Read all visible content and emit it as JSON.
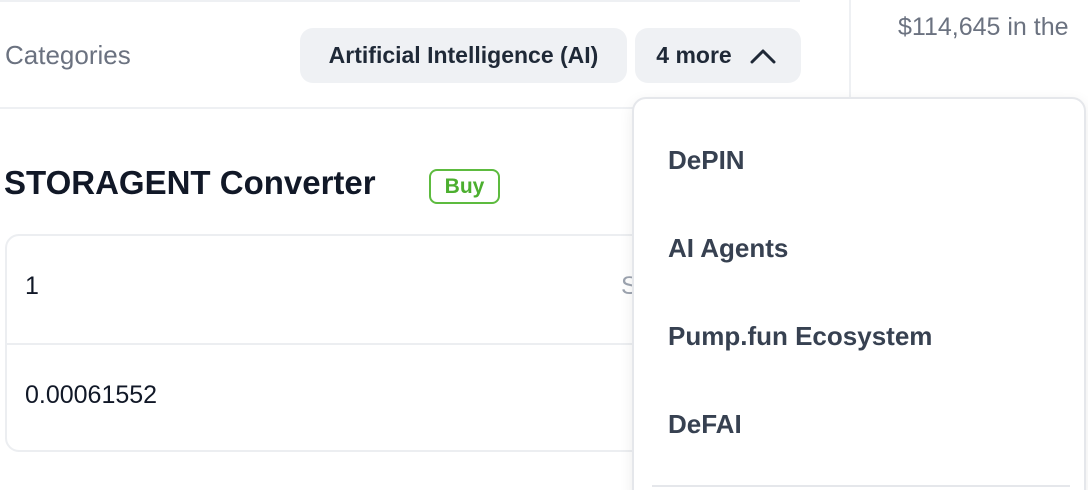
{
  "categories": {
    "label": "Categories",
    "primary_chip": "Artificial Intelligence (AI)",
    "more_chip": "4 more",
    "more_icon": "chevron-up-icon",
    "dropdown_items": [
      "DePIN",
      "AI Agents",
      "Pump.fun Ecosystem",
      "DeFAI"
    ]
  },
  "side": {
    "price_text": "$114,645 in the"
  },
  "converter": {
    "title": "STORAGENT Converter",
    "buy_label": "Buy",
    "input_value": "1",
    "input_unit_partial": "S",
    "output_value": "0.00061552"
  },
  "colors": {
    "buy_accent": "#4caf2f",
    "chip_bg": "#eff1f4",
    "muted_text": "#6b7280"
  }
}
